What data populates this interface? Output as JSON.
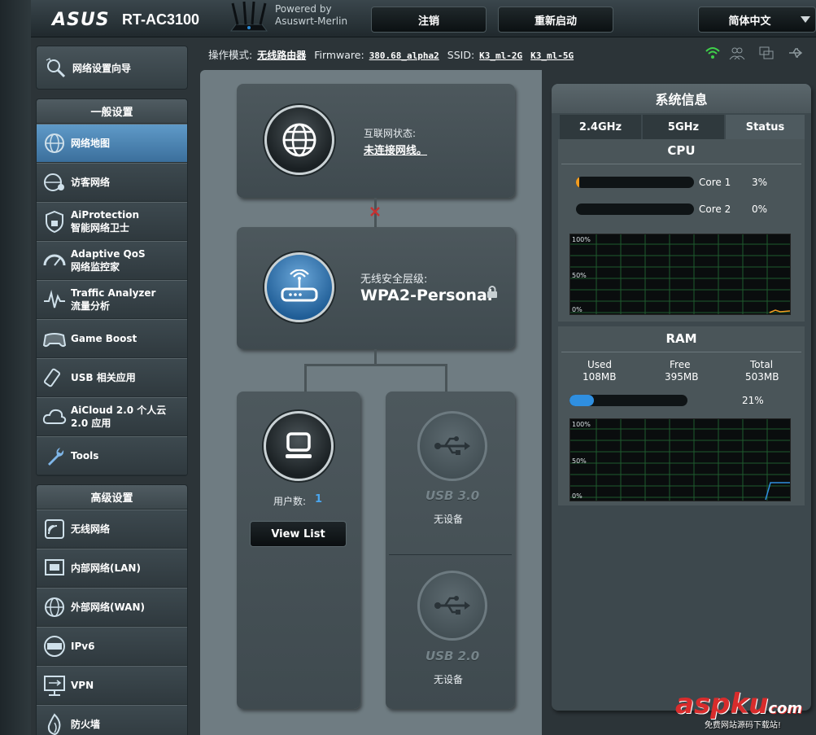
{
  "banner": {
    "logo": "ASUS",
    "model": "RT-AC3100",
    "powered_line1": "Powered by",
    "powered_line2": "Asuswrt-Merlin",
    "logout": "注销",
    "reboot": "重新启动",
    "language": "简体中文"
  },
  "status": {
    "mode_label": "操作模式:",
    "mode_value": "无线路由器",
    "fw_label": "Firmware:",
    "fw_value": "380.68_alpha2",
    "ssid_label": "SSID:",
    "ssid_2g": "K3_ml-2G",
    "ssid_5g": "K3_ml-5G"
  },
  "sidebar": {
    "wizard": "网络设置向导",
    "general_header": "一般设置",
    "general": [
      {
        "line1": "网络地图",
        "line2": "",
        "icon": "globe-icon"
      },
      {
        "line1": "访客网络",
        "line2": "",
        "icon": "guest-network-icon"
      },
      {
        "line1": "AiProtection",
        "line2": "智能网络卫士",
        "icon": "shield-icon"
      },
      {
        "line1": "Adaptive QoS",
        "line2": "网络监控家",
        "icon": "gauge-icon"
      },
      {
        "line1": "Traffic Analyzer",
        "line2": "流量分析",
        "icon": "traffic-icon"
      },
      {
        "line1": "Game Boost",
        "line2": "",
        "icon": "gamepad-icon"
      },
      {
        "line1": "USB 相关应用",
        "line2": "",
        "icon": "usb-stick-icon"
      },
      {
        "line1": "AiCloud 2.0 个人云",
        "line2": "2.0 应用",
        "icon": "cloud-icon"
      },
      {
        "line1": "Tools",
        "line2": "",
        "icon": "wrench-icon"
      }
    ],
    "advanced_header": "高级设置",
    "advanced": [
      {
        "line1": "无线网络",
        "icon": "wireless-icon"
      },
      {
        "line1": "内部网络(LAN)",
        "icon": "lan-icon"
      },
      {
        "line1": "外部网络(WAN)",
        "icon": "wan-globe-icon"
      },
      {
        "line1": "IPv6",
        "icon": "ipv6-icon"
      },
      {
        "line1": "VPN",
        "icon": "vpn-icon"
      },
      {
        "line1": "防火墙",
        "icon": "firewall-icon"
      }
    ]
  },
  "map": {
    "internet_label": "互联网状态:",
    "internet_value": "未连接网线。",
    "security_label": "无线安全层级:",
    "security_value": "WPA2-Personal",
    "clients_label": "用户数:",
    "clients_value": "1",
    "view_list": "View List",
    "usb3_title": "USB 3.0",
    "usb3_status": "无设备",
    "usb2_title": "USB 2.0",
    "usb2_status": "无设备"
  },
  "sysinfo": {
    "title": "系统信息",
    "tabs": [
      "2.4GHz",
      "5GHz",
      "Status"
    ],
    "active_tab": "Status",
    "cpu_title": "CPU",
    "cores": [
      {
        "name": "Core 1",
        "percent": "3%",
        "fill": 0.03
      },
      {
        "name": "Core 2",
        "percent": "0%",
        "fill": 0.0
      }
    ],
    "graph_100": "100%",
    "graph_50": "50%",
    "graph_0": "0%",
    "ram_title": "RAM",
    "used_label": "Used",
    "used_value": "108MB",
    "free_label": "Free",
    "free_value": "395MB",
    "total_label": "Total",
    "total_value": "503MB",
    "ram_percent": "21%",
    "ram_fill": 0.21
  },
  "colors": {
    "active_menu": "#4a82b3",
    "cpu_bar": "#f39c1f",
    "ram_bar": "#2f8fe0",
    "graph_grid": "#1f5a2e"
  },
  "watermark": {
    "text": "aspku",
    "suffix": "com",
    "sub": "免费网站源码下载站!"
  }
}
